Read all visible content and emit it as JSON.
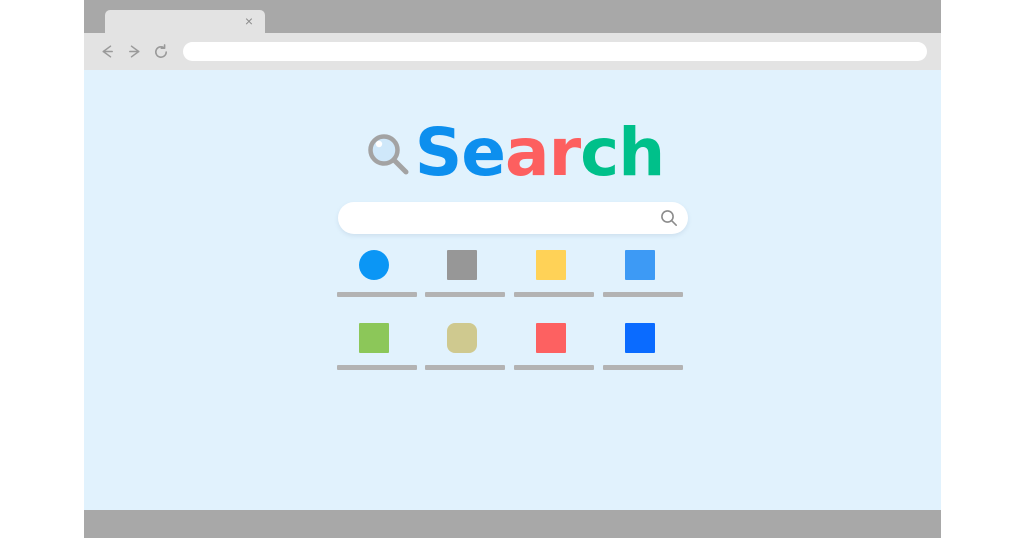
{
  "browser": {
    "tab": {
      "title": "",
      "close_icon": "close-icon",
      "close_glyph": "×"
    },
    "toolbar": {
      "back_icon": "arrow-left-icon",
      "forward_icon": "arrow-right-icon",
      "reload_icon": "reload-icon",
      "url_value": "",
      "url_placeholder": ""
    }
  },
  "page": {
    "background_color": "#e1f2fd",
    "logo": {
      "magnifier_icon": "magnifier-icon",
      "magnifier_ring_color": "#a3a3a3",
      "magnifier_lens_color": "#cfe8fa",
      "parts": [
        {
          "text": "Se",
          "color": "#0d8fee"
        },
        {
          "text": "ar",
          "color": "#fd5f5f"
        },
        {
          "text": "ch",
          "color": "#00c08a"
        }
      ],
      "full_text": "Search"
    },
    "search": {
      "value": "",
      "placeholder": "",
      "submit_icon": "search-icon",
      "submit_icon_color": "#8c8c8c"
    },
    "results": [
      {
        "label": "",
        "tile_color": "#0b96f5",
        "tile_shape": "round",
        "underline_color": "#b3b3b3"
      },
      {
        "label": "",
        "tile_color": "#979797",
        "tile_shape": "square",
        "underline_color": "#b3b3b3"
      },
      {
        "label": "",
        "tile_color": "#ffd257",
        "tile_shape": "square",
        "underline_color": "#b3b3b3"
      },
      {
        "label": "",
        "tile_color": "#3d9af5",
        "tile_shape": "square",
        "underline_color": "#b3b3b3"
      },
      {
        "label": "",
        "tile_color": "#8cc759",
        "tile_shape": "square",
        "underline_color": "#b3b3b3"
      },
      {
        "label": "",
        "tile_color": "#cfc98f",
        "tile_shape": "rounded",
        "underline_color": "#b3b3b3"
      },
      {
        "label": "",
        "tile_color": "#fd6161",
        "tile_shape": "square",
        "underline_color": "#b3b3b3"
      },
      {
        "label": "",
        "tile_color": "#0a6bff",
        "tile_shape": "square",
        "underline_color": "#b3b3b3"
      }
    ]
  },
  "colors": {
    "window_frame": "#a8a8a8",
    "chrome_light": "#e3e3e3",
    "page_background": "#e1f2fd",
    "canvas": "#ffffff"
  }
}
